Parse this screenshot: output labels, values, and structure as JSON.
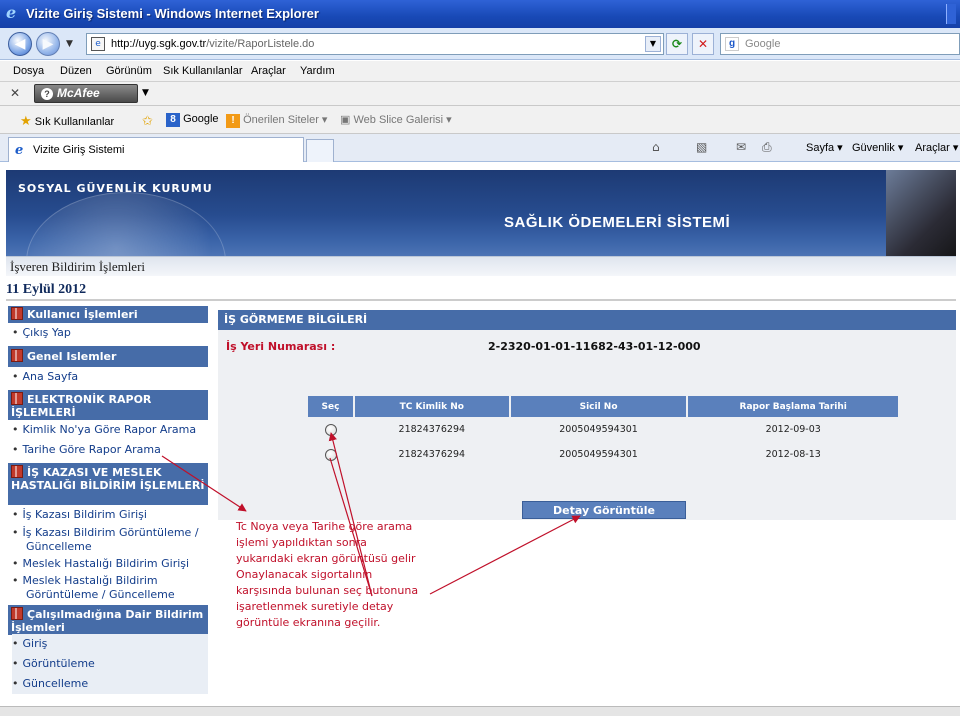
{
  "window": {
    "title": "Vizite Giriş Sistemi - Windows Internet Explorer"
  },
  "address": {
    "url_host": "http://uyg.sgk.gov.tr",
    "url_path": "/vizite/RaporListele.do",
    "search_placeholder": "Google"
  },
  "menubar": [
    "Dosya",
    "Düzen",
    "Görünüm",
    "Sık Kullanılanlar",
    "Araçlar",
    "Yardım"
  ],
  "mcafee": {
    "label": "McAfee"
  },
  "favorites": {
    "fav_label": "Sık Kullanılanlar",
    "google_label": "Google",
    "suggested_label": "Önerilen Siteler ▾",
    "webslice_label": "Web Slice Galerisi ▾"
  },
  "tab": {
    "label": "Vizite Giriş Sistemi"
  },
  "commands": {
    "page": "Sayfa ▾",
    "safety": "Güvenlik ▾",
    "tools": "Araçlar ▾"
  },
  "banner": {
    "brand": "SOSYAL GÜVENLİK KURUMU",
    "title": "SAĞLIK ÖDEMELERİ SİSTEMİ"
  },
  "subheader": "İşveren Bildirim İşlemleri",
  "date": "11 Eylül 2012",
  "sidebar": {
    "sections": [
      {
        "title": "Kullanıcı İşlemleri",
        "items": [
          "Çıkış Yap"
        ]
      },
      {
        "title": "Genel Islemler",
        "items": [
          "Ana Sayfa"
        ]
      },
      {
        "title": "ELEKTRONİK RAPOR İŞLEMLERİ",
        "items": [
          "Kimlik No'ya Göre Rapor Arama",
          "Tarihe Göre Rapor Arama"
        ]
      },
      {
        "title": "İŞ KAZASI VE MESLEK HASTALIĞI BİLDİRİM İŞLEMLERİ",
        "items": [
          "İş Kazası Bildirim Girişi",
          "İş Kazası Bildirim Görüntüleme / Güncelleme",
          "Meslek Hastalığı Bildirim Girişi",
          "Meslek Hastalığı Bildirim Görüntüleme / Güncelleme"
        ]
      },
      {
        "title": "Çalışılmadığına Dair Bildirim İşlemleri",
        "items": [
          "Giriş",
          "Görüntüleme",
          "Güncelleme"
        ]
      }
    ]
  },
  "main": {
    "heading": "İŞ GÖRMEME BİLGİLERİ",
    "isyeri_label": "İş Yeri Numarası :",
    "isyeri_value": "2-2320-01-01-11682-43-01-12-000",
    "columns": [
      "Seç",
      "TC Kimlik No",
      "Sicil No",
      "Rapor Başlama Tarihi"
    ],
    "rows": [
      {
        "tc": "21824376294",
        "sicil": "2005049594301",
        "tarih": "2012-09-03"
      },
      {
        "tc": "21824376294",
        "sicil": "2005049594301",
        "tarih": "2012-08-13"
      }
    ],
    "button_label": "Detay Görüntüle"
  },
  "annotation": {
    "text": "Tc Noya veya Tarihe göre arama\nişlemi yapıldıktan sonra\nyukarıdaki ekran görüntüsü gelir\nOnaylanacak sigortalının\nkarşısında bulunan seç butonuna\nişaretlenmek suretiyle detay\ngörüntüle ekranına geçilir.",
    "color": "#c0102a"
  },
  "colors": {
    "header_blue": "#466ca8",
    "grid_blue": "#5a80bc",
    "accent_red": "#c0102a"
  }
}
